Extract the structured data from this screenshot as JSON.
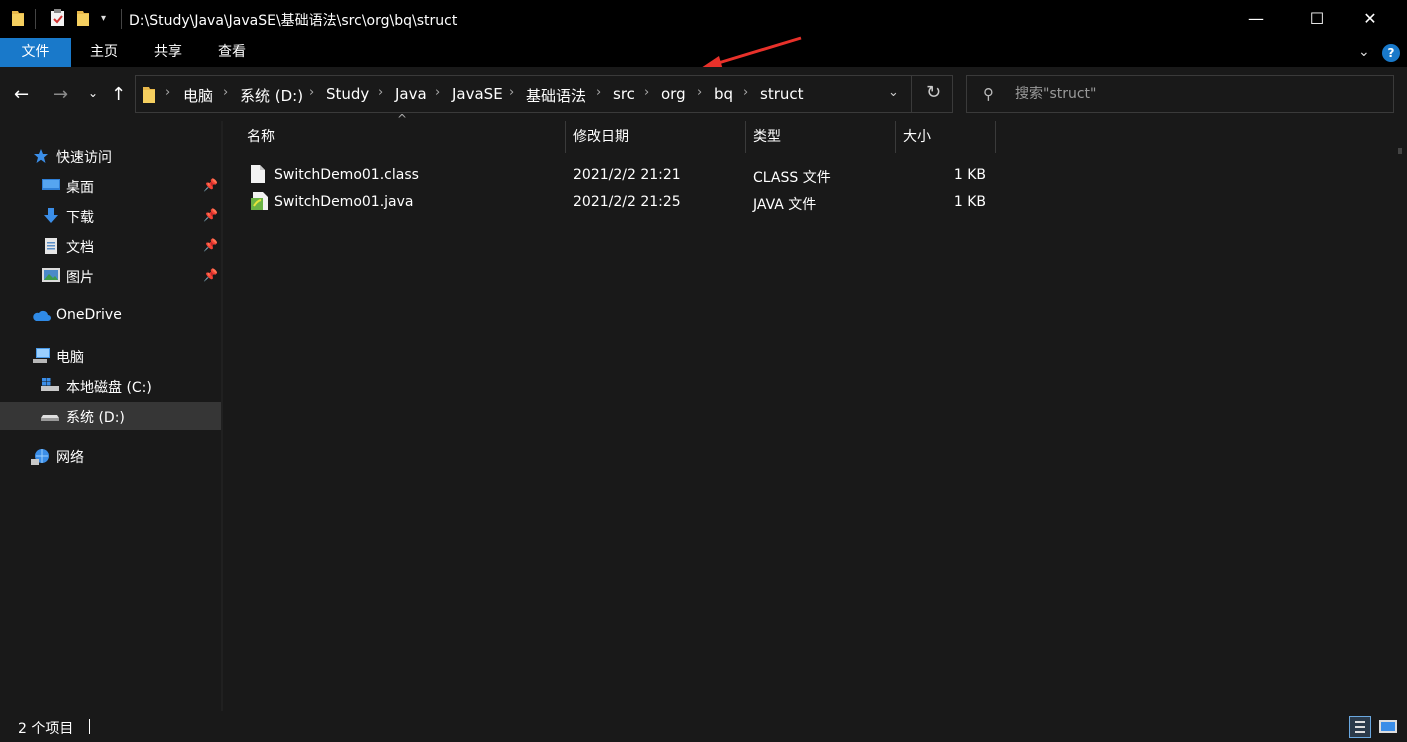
{
  "window": {
    "title": "D:\\Study\\Java\\JavaSE\\基础语法\\src\\org\\bq\\struct",
    "minimize_glyph": "—",
    "maximize_glyph": "☐",
    "close_glyph": "✕"
  },
  "ribbon": {
    "tabs": [
      {
        "label": "文件",
        "active": true
      },
      {
        "label": "主页"
      },
      {
        "label": "共享"
      },
      {
        "label": "查看"
      }
    ],
    "expand_glyph": "⌄",
    "help_glyph": "?"
  },
  "navigation": {
    "back_glyph": "←",
    "forward_glyph": "→",
    "recent_glyph": "⌄",
    "up_glyph": "↑"
  },
  "breadcrumb": [
    "电脑",
    "系统 (D:)",
    "Study",
    "Java",
    "JavaSE",
    "基础语法",
    "src",
    "org",
    "bq",
    "struct"
  ],
  "search": {
    "placeholder": "搜索\"struct\"",
    "value": ""
  },
  "sidebar": {
    "quick_access": {
      "label": "快速访问",
      "icon": "star-icon"
    },
    "pinned": [
      {
        "label": "桌面",
        "icon": "desktop-icon"
      },
      {
        "label": "下载",
        "icon": "download-icon"
      },
      {
        "label": "文档",
        "icon": "document-icon"
      },
      {
        "label": "图片",
        "icon": "pictures-icon"
      }
    ],
    "onedrive": {
      "label": "OneDrive",
      "icon": "cloud-icon"
    },
    "this_pc": {
      "label": "电脑",
      "icon": "computer-icon"
    },
    "drives": [
      {
        "label": "本地磁盘 (C:)",
        "icon": "windows-drive-icon",
        "selected": false
      },
      {
        "label": "系统 (D:)",
        "icon": "drive-icon",
        "selected": true
      }
    ],
    "network": {
      "label": "网络",
      "icon": "network-icon"
    }
  },
  "columns": {
    "name": "名称",
    "modified": "修改日期",
    "type": "类型",
    "size": "大小"
  },
  "files": [
    {
      "name": "SwitchDemo01.class",
      "modified": "2021/2/2 21:21",
      "type": "CLASS 文件",
      "size": "1 KB",
      "icon": "file-icon"
    },
    {
      "name": "SwitchDemo01.java",
      "modified": "2021/2/2 21:25",
      "type": "JAVA 文件",
      "size": "1 KB",
      "icon": "java-file-icon"
    }
  ],
  "status": {
    "item_count": "2 个项目"
  },
  "colors": {
    "accent": "#1979ca",
    "background": "#191919",
    "titlebar": "#000000",
    "annotation": "#e8312a"
  }
}
